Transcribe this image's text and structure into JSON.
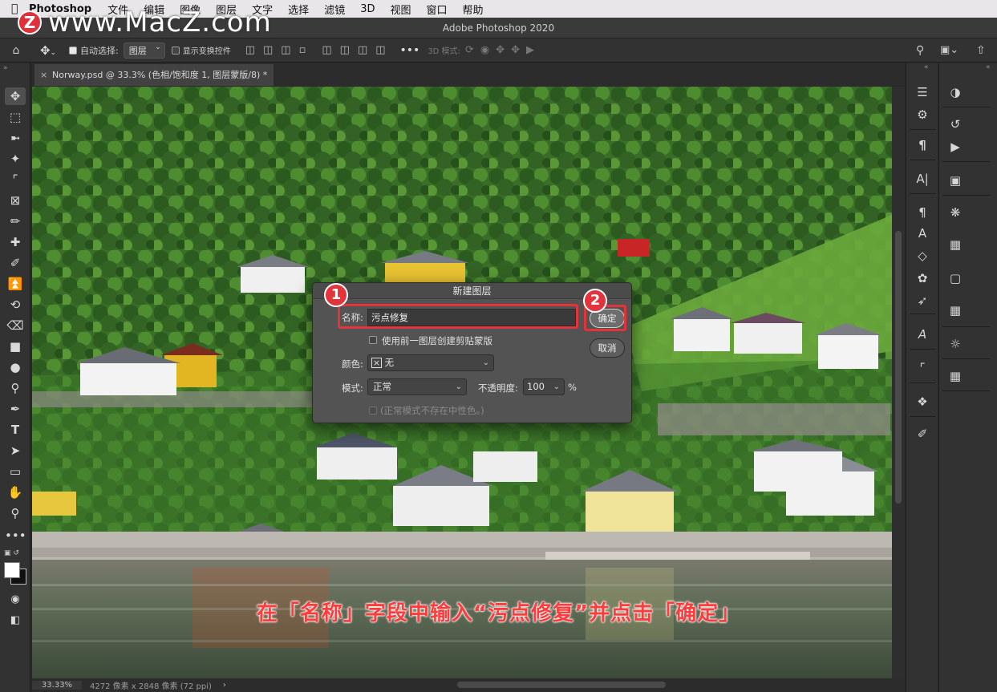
{
  "menubar": {
    "app": "Photoshop",
    "items": [
      "文件",
      "编辑",
      "图像",
      "图层",
      "文字",
      "选择",
      "滤镜",
      "3D",
      "视图",
      "窗口",
      "帮助"
    ]
  },
  "window": {
    "title": "Adobe Photoshop 2020"
  },
  "watermark": {
    "logo": "Z",
    "text": "www.MacZ.com"
  },
  "options_bar": {
    "auto_select_label": "自动选择:",
    "auto_select_checked": true,
    "auto_select_target": "图层",
    "show_transform_label": "显示变换控件",
    "show_transform_checked": false,
    "mode_3d_label": "3D 模式:"
  },
  "document_tab": {
    "label": "Norway.psd @ 33.3% (色相/饱和度 1, 图层蒙版/8) *"
  },
  "status_bar": {
    "zoom": "33.33%",
    "doc_info": "4272 像素 x 2848 像素 (72 ppi)",
    "arrow": "›"
  },
  "dialog": {
    "title": "新建图层",
    "name_label": "名称:",
    "name_value": "污点修复",
    "clip_checkbox_label": "使用前一图层创建剪贴蒙版",
    "clip_checked": false,
    "color_label": "颜色:",
    "color_value": "无",
    "mode_label": "模式:",
    "mode_value": "正常",
    "opacity_label": "不透明度:",
    "opacity_value": "100",
    "opacity_unit": "%",
    "neutral_label": "(正常模式不存在中性色。)",
    "ok_label": "确定",
    "cancel_label": "取消"
  },
  "callouts": {
    "badge1": "1",
    "badge2": "2"
  },
  "caption": "在「名称」字段中输入“污点修复”并点击「确定」",
  "colors": {
    "accent_red": "#e2343a",
    "panel_bg": "#323232",
    "dialog_bg": "#535353"
  }
}
